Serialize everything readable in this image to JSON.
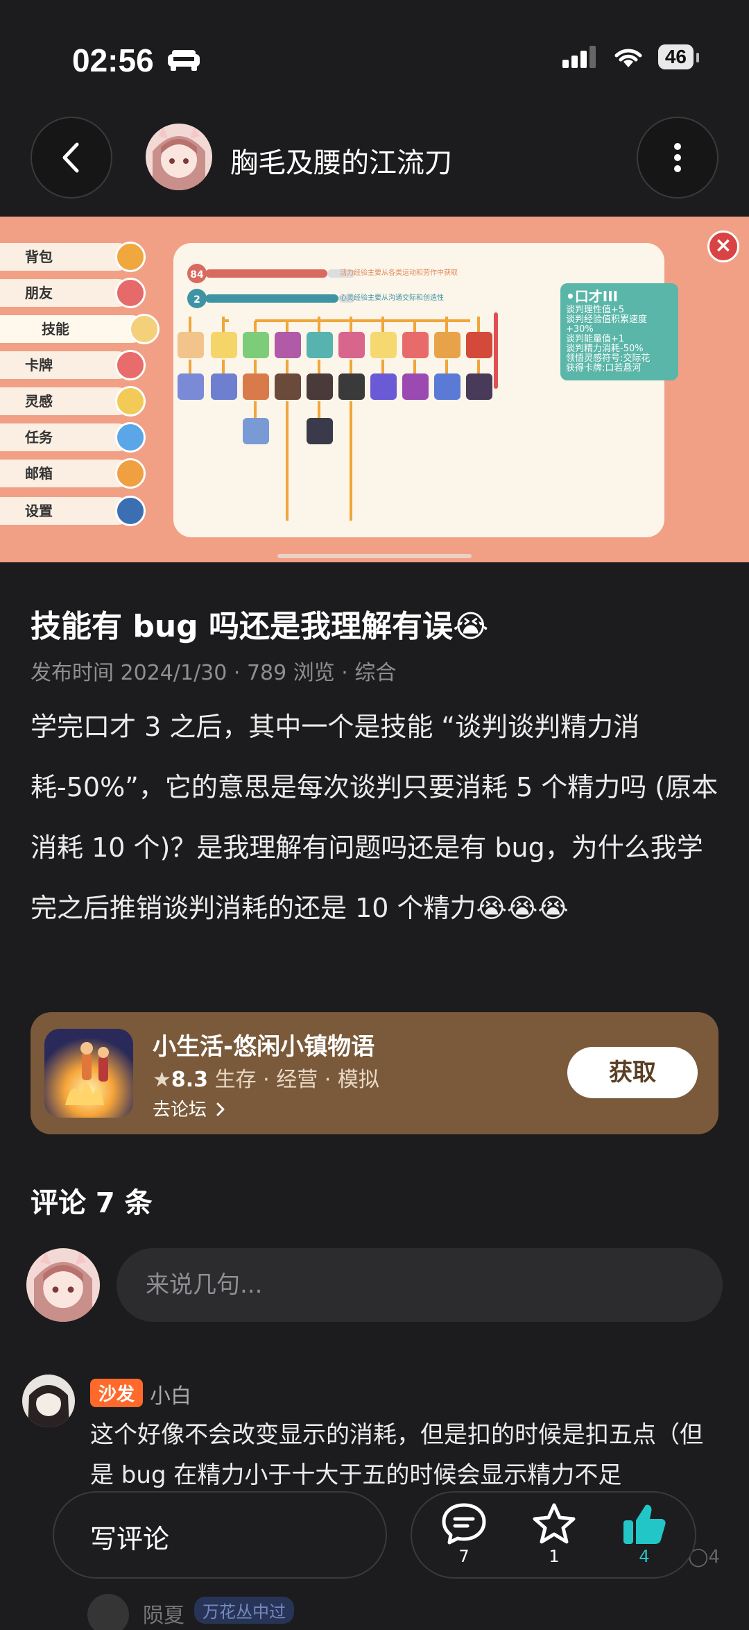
{
  "status_bar": {
    "time": "02:56",
    "battery": "46"
  },
  "header": {
    "author_name": "胸毛及腰的江流刀"
  },
  "banner": {
    "menu": [
      "背包",
      "朋友",
      "技能",
      "卡牌",
      "灵感",
      "任务",
      "邮箱",
      "设置"
    ],
    "vitality_value": "84",
    "vitality_caption": "活力经验主要从各类运动和劳作中获取",
    "mind_value": "2",
    "mind_caption": "心灵经验主要从沟通交际和创造性",
    "tooltip_title": "•口才III",
    "tooltip_lines": [
      "谈判理性值+5",
      "谈判经验值积累速度+30%",
      "谈判能量值+1",
      "谈判精力消耗-50%",
      "领悟灵感符号:交际花",
      "获得卡牌:口若悬河"
    ]
  },
  "post": {
    "title": "技能有 bug 吗还是我理解有误😭",
    "meta": "发布时间 2024/1/30 · 789 浏览 · 综合",
    "body": "学完口才 3 之后，其中一个是技能 “谈判谈判精力消耗-50%”，它的意思是每次谈判只要消耗 5 个精力吗 (原本消耗 10 个)？是我理解有问题吗还是有 bug，为什么我学完之后推销谈判消耗的还是 10 个精力😭😭😭"
  },
  "app_card": {
    "name": "小生活-悠闲小镇物语",
    "rating": "8.3",
    "tags": "生存 · 经营 · 模拟",
    "forum_link": "去论坛",
    "get_button": "获取"
  },
  "comments": {
    "title": "评论 7 条",
    "input_placeholder": "来说几句...",
    "items": [
      {
        "badge": "沙发",
        "user": "小白",
        "text": "这个好像不会改变显示的消耗，但是扣的时候是扣五点（但是 bug 在精力小于十大于五的时候会显示精力不足"
      }
    ],
    "next_user": "陨夏",
    "next_badge": "万花丛中过",
    "reply_count": "4"
  },
  "bottom_bar": {
    "write_comment": "写评论",
    "comment_count": "7",
    "favorite_count": "1",
    "like_count": "4"
  },
  "colors": {
    "accent_like": "#22c6c6",
    "app_card_bg": "#7a5a3a",
    "sofa_badge": "#ff6a2b",
    "banner_bg": "#f1a085"
  }
}
